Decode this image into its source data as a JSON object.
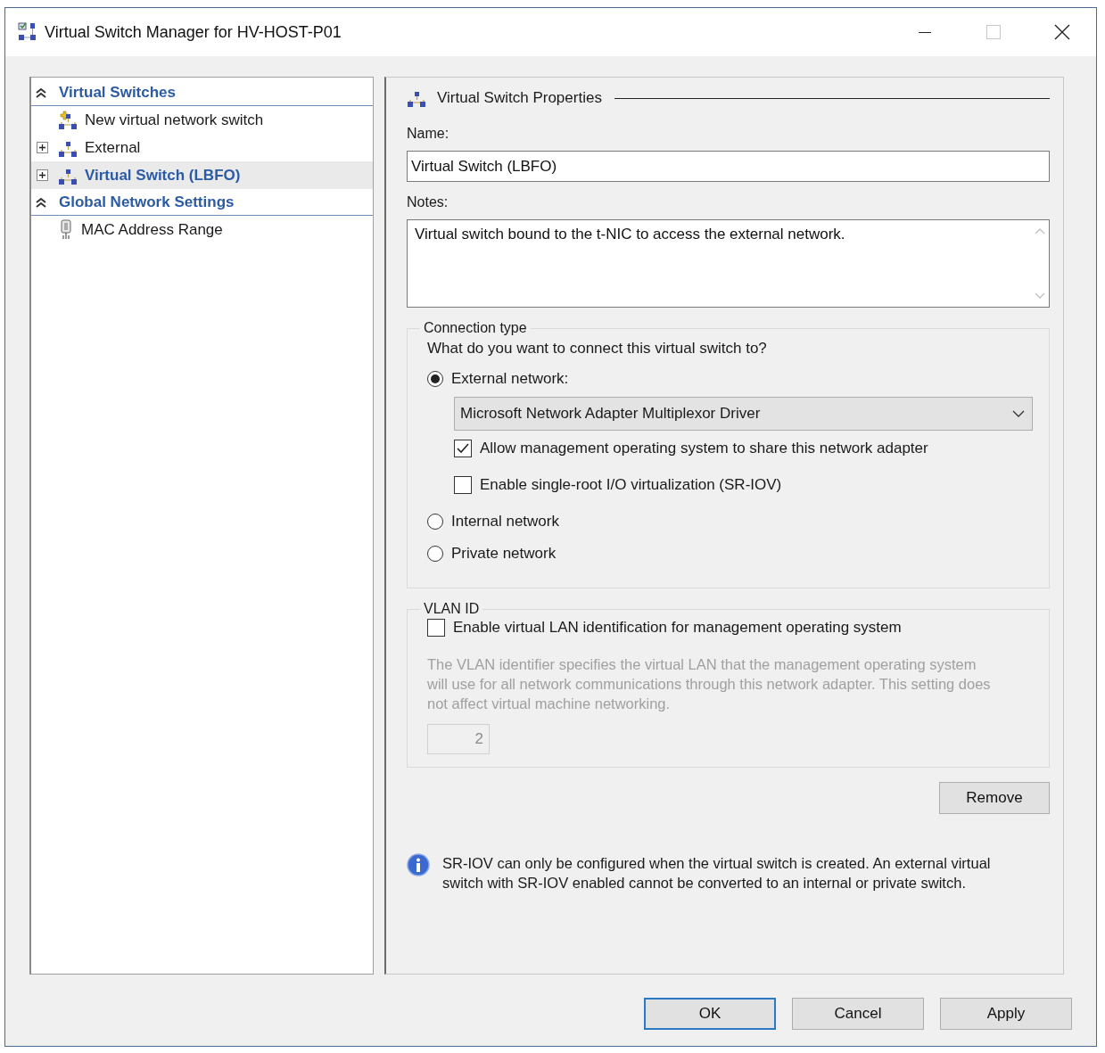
{
  "window": {
    "title": "Virtual Switch Manager for HV-HOST-P01"
  },
  "sidebar": {
    "sections": [
      {
        "title": "Virtual Switches",
        "expanded": true,
        "items": [
          {
            "label": "New virtual network switch",
            "kind": "new-switch",
            "selected": false
          },
          {
            "label": "External",
            "kind": "switch",
            "expanded": false,
            "selected": false
          },
          {
            "label": "Virtual Switch (LBFO)",
            "kind": "switch",
            "expanded": false,
            "selected": true
          }
        ]
      },
      {
        "title": "Global Network Settings",
        "expanded": true,
        "items": [
          {
            "label": "MAC Address Range",
            "kind": "mac",
            "selected": false
          }
        ]
      }
    ]
  },
  "properties": {
    "title": "Virtual Switch Properties",
    "name": {
      "label": "Name:",
      "value": "Virtual Switch (LBFO)"
    },
    "notes": {
      "label": "Notes:",
      "value": "Virtual switch bound to the t-NIC to access the external network."
    },
    "connection_type": {
      "legend": "Connection type",
      "question": "What do you want to connect this virtual switch to?",
      "options": [
        {
          "label": "External network:",
          "selected": true,
          "adapter": {
            "value": "Microsoft Network Adapter Multiplexor Driver"
          },
          "settings": [
            {
              "label": "Allow management operating system to share this network adapter",
              "checked": true
            },
            {
              "label": "Enable single-root I/O virtualization (SR-IOV)",
              "checked": false
            }
          ]
        },
        {
          "label": "Internal network",
          "selected": false
        },
        {
          "label": "Private network",
          "selected": false
        }
      ]
    },
    "vlan": {
      "legend": "VLAN ID",
      "checkbox": {
        "label": "Enable virtual LAN identification for management operating system",
        "checked": false
      },
      "description": "The VLAN identifier specifies the virtual LAN that the management operating system will use for all network communications through this network adapter. This setting does not affect virtual machine networking.",
      "value": "2",
      "disabled": true
    },
    "remove_button": "Remove",
    "info": "SR-IOV can only be configured when the virtual switch is created. An external virtual switch with SR-IOV enabled cannot be converted to an internal or private switch."
  },
  "buttons": [
    {
      "label": "OK",
      "default": true
    },
    {
      "label": "Cancel",
      "default": false
    },
    {
      "label": "Apply",
      "default": false
    }
  ]
}
